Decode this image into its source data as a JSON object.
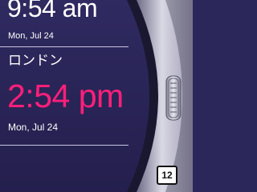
{
  "local": {
    "time": "9:54 am",
    "date": "Mon, Jul 24"
  },
  "remote": {
    "city": "ロンドン",
    "time": "2:54 pm",
    "date": "Mon, Jul 24"
  },
  "badge": {
    "count": "12"
  },
  "colors": {
    "background": "#2b275a",
    "accent": "#ff1f7a",
    "text": "#ffffff"
  },
  "icons": {
    "crown": "watch-crown-icon"
  }
}
